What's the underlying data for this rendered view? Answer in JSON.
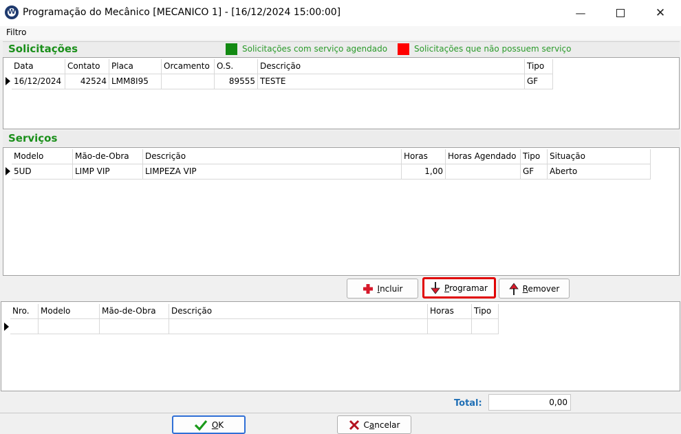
{
  "window": {
    "title": "Programação do Mecânico [MECANICO 1] - [16/12/2024 15:00:00]"
  },
  "menu": {
    "filtro": "Filtro"
  },
  "solicitacoes": {
    "title": "Solicitações",
    "legend": [
      {
        "label": "Solicitações com serviço agendado",
        "color": "#138a13"
      },
      {
        "label": "Solicitações que não possuem serviço",
        "color": "#ff0000"
      }
    ],
    "columns": [
      "Data",
      "Contato",
      "Placa",
      "Orcamento",
      "O.S.",
      "Descrição",
      "Tipo"
    ],
    "rows": [
      {
        "data": "16/12/2024",
        "contato": "42524",
        "placa": "LMM8I95",
        "orcamento": "",
        "os": "89555",
        "descricao": "TESTE",
        "tipo": "GF"
      }
    ]
  },
  "servicos": {
    "title": "Serviços",
    "columns": [
      "Modelo",
      "Mão-de-Obra",
      "Descrição",
      "Horas",
      "Horas Agendado",
      "Tipo",
      "Situação"
    ],
    "rows": [
      {
        "modelo": "5UD",
        "mao_de_obra": "LIMP VIP",
        "descricao": "LIMPEZA VIP",
        "horas": "1,00",
        "horas_agendado": "",
        "tipo": "GF",
        "situacao": "Aberto"
      }
    ]
  },
  "actions": {
    "incluir": {
      "prefix": "",
      "accel": "I",
      "rest": "ncluir"
    },
    "programar": {
      "prefix": "",
      "accel": "P",
      "rest": "rogramar"
    },
    "remover": {
      "prefix": "",
      "accel": "R",
      "rest": "emover"
    }
  },
  "programados": {
    "columns": [
      "Nro.",
      "Modelo",
      "Mão-de-Obra",
      "Descrição",
      "Horas",
      "Tipo"
    ],
    "rows": [
      {}
    ]
  },
  "total": {
    "label": "Total:",
    "value": "0,00"
  },
  "footer": {
    "ok": {
      "accel": "O",
      "rest": "K"
    },
    "cancelar": {
      "prefix": "C",
      "accel": "a",
      "rest": "ncelar"
    }
  }
}
